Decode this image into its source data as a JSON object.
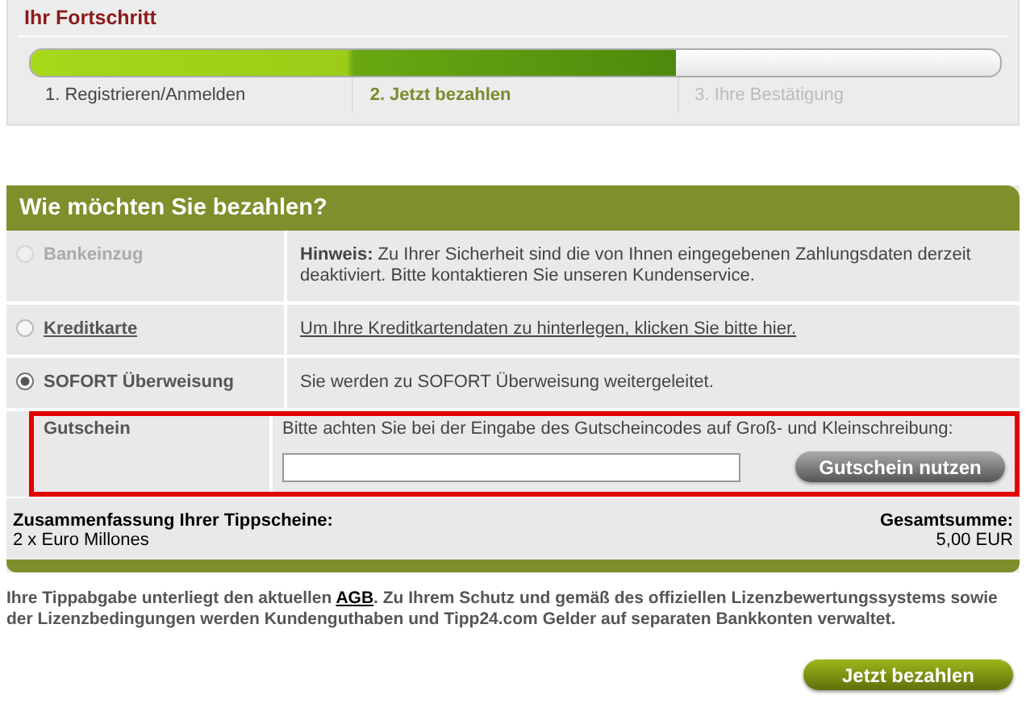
{
  "progress": {
    "title": "Ihr Fortschritt",
    "level": 0.665,
    "steps": [
      {
        "label": "1. Registrieren/Anmelden",
        "reached": true,
        "selected": false
      },
      {
        "label": "2. Jetzt bezahlen",
        "reached": true,
        "selected": true
      },
      {
        "label": "3. Ihre Bestätigung",
        "reached": false,
        "selected": false
      }
    ]
  },
  "payment": {
    "title": "Wie möchten Sie bezahlen?",
    "methods": [
      {
        "kind": "radio",
        "label": "Bankeinzug",
        "selected": false,
        "disabled": true,
        "link": false,
        "note_bold": "Hinweis:",
        "note": "Zu Ihrer Sicherheit sind die von Ihnen eingegebenen Zahlungsdaten derzeit deaktiviert. Bitte kontaktieren Sie unseren Kundenservice."
      },
      {
        "kind": "radio",
        "label": "Kreditkarte",
        "selected": false,
        "disabled": false,
        "link": true,
        "note": "Um Ihre Kreditkartendaten zu hinterlegen, klicken Sie bitte hier."
      },
      {
        "kind": "radio",
        "label": "SOFORT Überweisung",
        "selected": true,
        "disabled": false,
        "link": false,
        "note": "Sie werden zu SOFORT Überweisung weitergeleitet."
      },
      {
        "kind": "voucher",
        "label": "Gutschein",
        "highlighted": true,
        "note": "Bitte achten Sie bei der Eingabe des Gutscheincodes auf Groß- und Kleinschreibung:",
        "button": "Gutschein nutzen"
      }
    ],
    "summary": {
      "title": "Zusammenfassung Ihrer Tippscheine:",
      "item": "2 x Euro Millones",
      "total_label": "Gesamtsumme:",
      "total": "5,00 EUR"
    }
  },
  "legal": {
    "before": "Ihre Tippabgabe unterliegt den aktuellen",
    "link": "AGB",
    "after": ". Zu Ihrem Schutz und gemäß des offiziellen Lizenzbewertungssystems sowie der Lizenzbedingungen werden Kundenguthaben und Tipp24.com Gelder auf separaten Bankkonten verwaltet."
  },
  "pay_button": "Jetzt bezahlen"
}
